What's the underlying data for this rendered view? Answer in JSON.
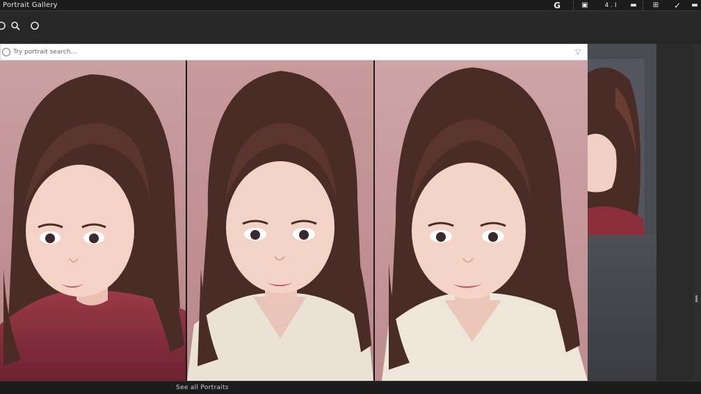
{
  "window": {
    "title": "Portrait Gallery"
  },
  "titlebar_icons": [
    {
      "name": "g-icon",
      "glyph": "G"
    },
    {
      "name": "image-icon",
      "glyph": "▣"
    },
    {
      "name": "page-counter",
      "glyph": "4 . I"
    },
    {
      "name": "rect-icon",
      "glyph": "▬"
    },
    {
      "name": "grid-icon",
      "glyph": "⊞"
    },
    {
      "name": "check-icon",
      "glyph": "✓"
    },
    {
      "name": "minimize-icon",
      "glyph": "▬"
    }
  ],
  "toolbar": {
    "tools": [
      "pointer-icon",
      "search-icon",
      "circle-icon"
    ]
  },
  "search": {
    "placeholder": "Try portrait search..."
  },
  "gallery": {
    "photos": [
      {
        "name": "portrait-red-sweater",
        "sweater_color": "#8a2e3c"
      },
      {
        "name": "portrait-cream-sweater",
        "sweater_color": "#eae2d4"
      },
      {
        "name": "portrait-cream-sweater-large",
        "sweater_color": "#eee6d8"
      }
    ]
  },
  "side_panel": {
    "thumb_name": "portrait-profile"
  },
  "status": {
    "text": "See all Portraits"
  },
  "colors": {
    "background": "#262626",
    "photo_backdrop": "#c99a9c",
    "hair": "#4a2c26",
    "skin": "#f4d2c6"
  }
}
